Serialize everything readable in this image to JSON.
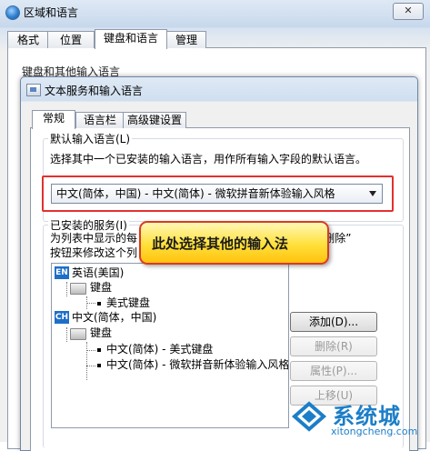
{
  "outer_window": {
    "title": "区域和语言",
    "close_label": "✕",
    "tabs": [
      {
        "label": "格式"
      },
      {
        "label": "位置"
      },
      {
        "label": "键盘和语言"
      },
      {
        "label": "管理"
      }
    ],
    "group_label": "键盘和其他输入语言"
  },
  "dialog": {
    "title": "文本服务和输入语言",
    "tabs": [
      {
        "label": "常规"
      },
      {
        "label": "语言栏"
      },
      {
        "label": "高级键设置"
      }
    ],
    "default_language": {
      "label": "默认输入语言(L)",
      "description": "选择其中一个已安装的输入语言，用作所有输入字段的默认语言。",
      "selected": "中文(简体，中国) - 中文(简体) - 微软拼音新体验输入风格"
    },
    "installed_services": {
      "label": "已安装的服务(I)",
      "description_line1": "为列表中显示的每",
      "description_line1_end": "“删除”",
      "description_line2": "按钮来修改这个列",
      "tree": [
        {
          "badge": "EN",
          "label": "英语(美国)"
        },
        {
          "label": "键盘"
        },
        {
          "label": "美式键盘"
        },
        {
          "badge": "CH",
          "label": "中文(简体，中国)"
        },
        {
          "label": "键盘"
        },
        {
          "label": "中文(简体) - 美式键盘"
        },
        {
          "label": "中文(简体) - 微软拼音新体验输入风格"
        }
      ]
    },
    "buttons": {
      "add": "添加(D)...",
      "remove": "删除(R)",
      "properties": "属性(P)...",
      "move_up": "上移(U)"
    }
  },
  "callout": {
    "text": "此处选择其他的输入法",
    "fill_color": "#ffd21a",
    "border_color": "#d93a25"
  },
  "watermark": {
    "brand": "系统城",
    "url": "xitongcheng.com",
    "color": "#1c7ec8"
  }
}
